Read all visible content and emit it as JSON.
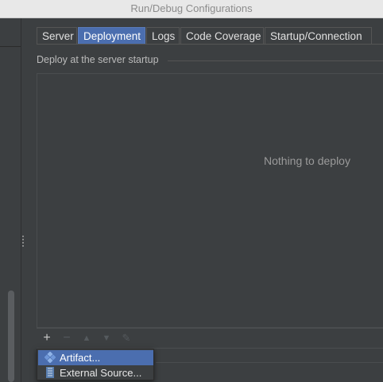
{
  "window": {
    "title": "Run/Debug Configurations"
  },
  "tabs": [
    {
      "label": "Server"
    },
    {
      "label": "Deployment"
    },
    {
      "label": "Logs"
    },
    {
      "label": "Code Coverage"
    },
    {
      "label": "Startup/Connection"
    }
  ],
  "active_tab": "Deployment",
  "deploy_section": {
    "label": "Deploy at the server startup",
    "empty_text": "Nothing to deploy"
  },
  "toolbar": {
    "add": "+",
    "remove": "−",
    "up": "▲",
    "down": "▼",
    "edit": "✎"
  },
  "popup_menu": {
    "items": [
      {
        "label": "Artifact...",
        "icon": "artifact-icon",
        "selected": true
      },
      {
        "label": "External Source...",
        "icon": "external-source-icon",
        "selected": false
      }
    ]
  },
  "colors": {
    "background": "#3c3f41",
    "accent": "#4b6eaf",
    "titlebar": "#e8e8e8"
  }
}
